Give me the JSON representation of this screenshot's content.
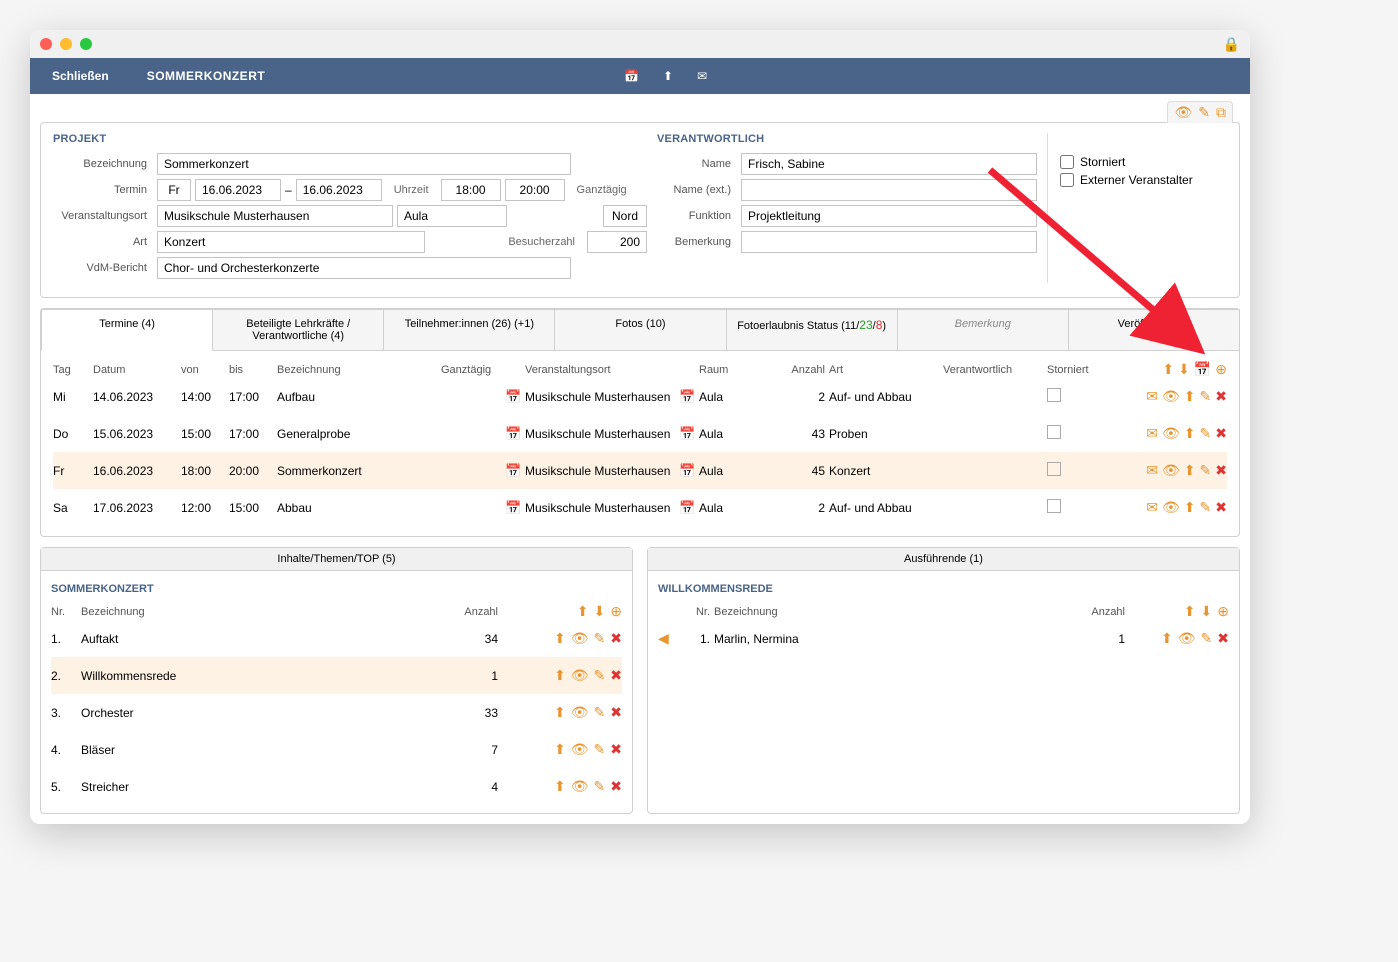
{
  "header": {
    "close": "Schließen",
    "title": "SOMMERKONZERT"
  },
  "project": {
    "section": "PROJEKT",
    "labels": {
      "bezeichnung": "Bezeichnung",
      "termin": "Termin",
      "uhrzeit": "Uhrzeit",
      "ganztagig": "Ganztägig",
      "veranstaltungsort": "Veranstaltungsort",
      "art": "Art",
      "besucherzahl": "Besucherzahl",
      "vdm": "VdM-Bericht"
    },
    "bezeichnung": "Sommerkonzert",
    "day": "Fr",
    "date_from": "16.06.2023",
    "date_to": "16.06.2023",
    "time_from": "18:00",
    "time_to": "20:00",
    "ort": "Musikschule Musterhausen",
    "raum": "Aula",
    "seite": "Nord",
    "art": "Konzert",
    "besucher": "200",
    "vdm": "Chor- und Orchesterkonzerte"
  },
  "resp": {
    "section": "VERANTWORTLICH",
    "labels": {
      "name": "Name",
      "name_ext": "Name (ext.)",
      "funktion": "Funktion",
      "bemerkung": "Bemerkung"
    },
    "name": "Frisch, Sabine",
    "name_ext": "",
    "funktion": "Projektleitung",
    "bemerkung": ""
  },
  "flags": {
    "storniert": "Storniert",
    "extern": "Externer Veranstalter"
  },
  "tabs": [
    "Termine (4)",
    "Beteiligte Lehrkräfte / Verantwortliche (4)",
    "Teilnehmer:innen (26) (+1)",
    "Fotos (10)",
    "Fotoerlaubnis Status (11/23/8)",
    "Bemerkung",
    "Veröffentlichen"
  ],
  "termine": {
    "headers": {
      "tag": "Tag",
      "datum": "Datum",
      "von": "von",
      "bis": "bis",
      "bezeichnung": "Bezeichnung",
      "ganztagig": "Ganztägig",
      "ort": "Veranstaltungsort",
      "raum": "Raum",
      "anzahl": "Anzahl",
      "art": "Art",
      "verantwortlich": "Verantwortlich",
      "storniert": "Storniert"
    },
    "rows": [
      {
        "tag": "Mi",
        "datum": "14.06.2023",
        "von": "14:00",
        "bis": "17:00",
        "bez": "Aufbau",
        "ort": "Musikschule Musterhausen",
        "raum": "Aula",
        "anzahl": "2",
        "art": "Auf- und Abbau",
        "hl": false
      },
      {
        "tag": "Do",
        "datum": "15.06.2023",
        "von": "15:00",
        "bis": "17:00",
        "bez": "Generalprobe",
        "ort": "Musikschule Musterhausen",
        "raum": "Aula",
        "anzahl": "43",
        "art": "Proben",
        "hl": false
      },
      {
        "tag": "Fr",
        "datum": "16.06.2023",
        "von": "18:00",
        "bis": "20:00",
        "bez": "Sommerkonzert",
        "ort": "Musikschule Musterhausen",
        "raum": "Aula",
        "anzahl": "45",
        "art": "Konzert",
        "hl": true
      },
      {
        "tag": "Sa",
        "datum": "17.06.2023",
        "von": "12:00",
        "bis": "15:00",
        "bez": "Abbau",
        "ort": "Musikschule Musterhausen",
        "raum": "Aula",
        "anzahl": "2",
        "art": "Auf- und Abbau",
        "hl": false
      }
    ]
  },
  "inhalte": {
    "title": "Inhalte/Themen/TOP (5)",
    "sub": "SOMMERKONZERT",
    "headers": {
      "nr": "Nr.",
      "bez": "Bezeichnung",
      "anzahl": "Anzahl"
    },
    "rows": [
      {
        "nr": "1.",
        "bez": "Auftakt",
        "anzahl": "34",
        "hl": false
      },
      {
        "nr": "2.",
        "bez": "Willkommensrede",
        "anzahl": "1",
        "hl": true
      },
      {
        "nr": "3.",
        "bez": "Orchester",
        "anzahl": "33",
        "hl": false
      },
      {
        "nr": "4.",
        "bez": "Bläser",
        "anzahl": "7",
        "hl": false
      },
      {
        "nr": "5.",
        "bez": "Streicher",
        "anzahl": "4",
        "hl": false
      }
    ]
  },
  "ausf": {
    "title": "Ausführende (1)",
    "sub": "WILLKOMMENSREDE",
    "headers": {
      "nr": "Nr.",
      "bez": "Bezeichnung",
      "anzahl": "Anzahl"
    },
    "rows": [
      {
        "nr": "1.",
        "bez": "Marlin, Nermina",
        "anzahl": "1",
        "hl": true
      }
    ]
  }
}
